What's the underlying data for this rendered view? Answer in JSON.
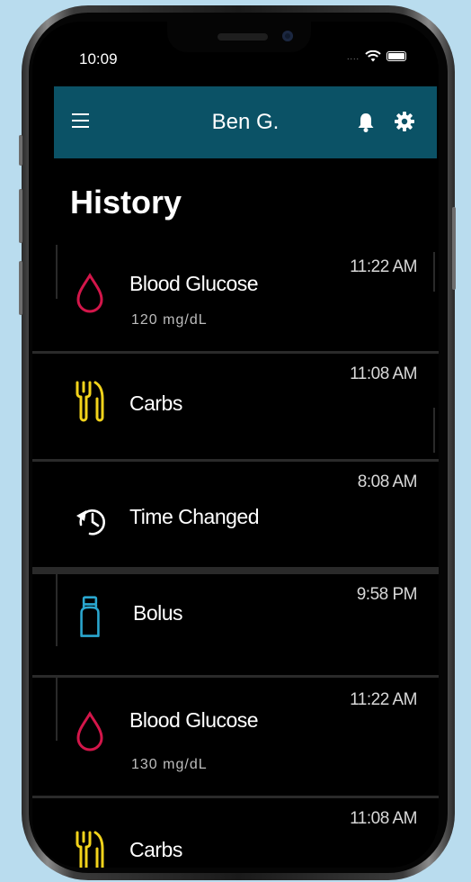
{
  "status_bar": {
    "time": "10:09",
    "signal": "...."
  },
  "header": {
    "title": "Ben G."
  },
  "page": {
    "title": "History"
  },
  "entries": [
    {
      "icon": "blood-drop-icon",
      "title": "Blood Glucose",
      "value": "120  mg/dL",
      "time": "11:22 AM"
    },
    {
      "icon": "carbs-icon",
      "title": "Carbs",
      "value": "",
      "time": "11:08 AM"
    },
    {
      "icon": "time-changed-icon",
      "title": "Time Changed",
      "value": "",
      "time": "8:08 AM"
    },
    {
      "icon": "bolus-vial-icon",
      "title": "Bolus",
      "value": "",
      "time": "9:58 PM"
    },
    {
      "icon": "blood-drop-icon",
      "title": "Blood Glucose",
      "value": "130  mg/dL",
      "time": "11:22 AM"
    },
    {
      "icon": "carbs-icon",
      "title": "Carbs",
      "value": "",
      "time": "11:08 AM"
    }
  ],
  "colors": {
    "background": "#b9dcee",
    "app_bar": "#0b5266",
    "blood_glucose": "#d3164a",
    "carbs": "#f2d31b",
    "bolus": "#2aa7cf"
  }
}
